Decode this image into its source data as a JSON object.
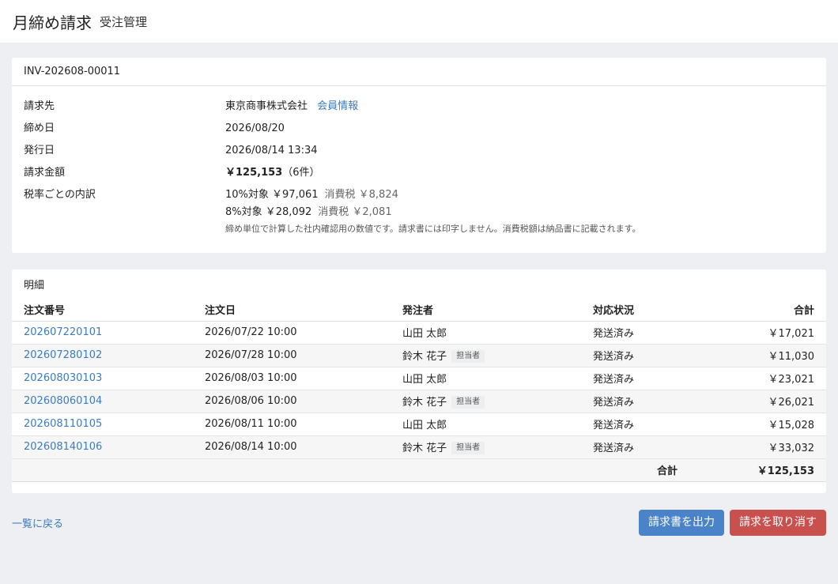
{
  "header": {
    "title": "月締め請求",
    "subtitle": "受注管理"
  },
  "invoice": {
    "id": "INV-202608-00011",
    "fields": {
      "billing_to_label": "請求先",
      "billing_to": "東京商事株式会社",
      "member_link": "会員情報",
      "closing_date_label": "締め日",
      "closing_date": "2026/08/20",
      "issue_date_label": "発行日",
      "issue_date": "2026/08/14 13:34",
      "amount_label": "請求金額",
      "amount": "￥125,153",
      "amount_count": "（6件）",
      "tax_breakdown_label": "税率ごとの内訳",
      "tax10_base": "10%対象 ￥97,061",
      "tax10_tax": "消費税 ￥8,824",
      "tax8_base": "8%対象 ￥28,092",
      "tax8_tax": "消費税 ￥2,081",
      "note": "締め単位で計算した社内確認用の数値です。請求書には印字しません。消費税額は納品書に記載されます。"
    }
  },
  "details": {
    "title": "明細",
    "columns": [
      "注文番号",
      "注文日",
      "発注者",
      "対応状況",
      "合計"
    ],
    "rows": [
      {
        "order_no": "202607220101",
        "date": "2026/07/22 10:00",
        "person": "山田 太郎",
        "badge": "",
        "status": "発送済み",
        "total": "￥17,021"
      },
      {
        "order_no": "202607280102",
        "date": "2026/07/28 10:00",
        "person": "鈴木 花子",
        "badge": "担当者",
        "status": "発送済み",
        "total": "￥11,030"
      },
      {
        "order_no": "202608030103",
        "date": "2026/08/03 10:00",
        "person": "山田 太郎",
        "badge": "",
        "status": "発送済み",
        "total": "￥23,021"
      },
      {
        "order_no": "202608060104",
        "date": "2026/08/06 10:00",
        "person": "鈴木 花子",
        "badge": "担当者",
        "status": "発送済み",
        "total": "￥26,021"
      },
      {
        "order_no": "202608110105",
        "date": "2026/08/11 10:00",
        "person": "山田 太郎",
        "badge": "",
        "status": "発送済み",
        "total": "￥15,028"
      },
      {
        "order_no": "202608140106",
        "date": "2026/08/14 10:00",
        "person": "鈴木 花子",
        "badge": "担当者",
        "status": "発送済み",
        "total": "￥33,032"
      }
    ],
    "total_label": "合計",
    "total_value": "￥125,153"
  },
  "footer": {
    "back_link": "一覧に戻る",
    "export_button": "請求書を出力",
    "cancel_button": "請求を取り消す"
  },
  "colors": {
    "link": "#3a7bc4",
    "primary": "#4a83c8",
    "danger": "#c8504e",
    "background": "#eeeff2"
  }
}
